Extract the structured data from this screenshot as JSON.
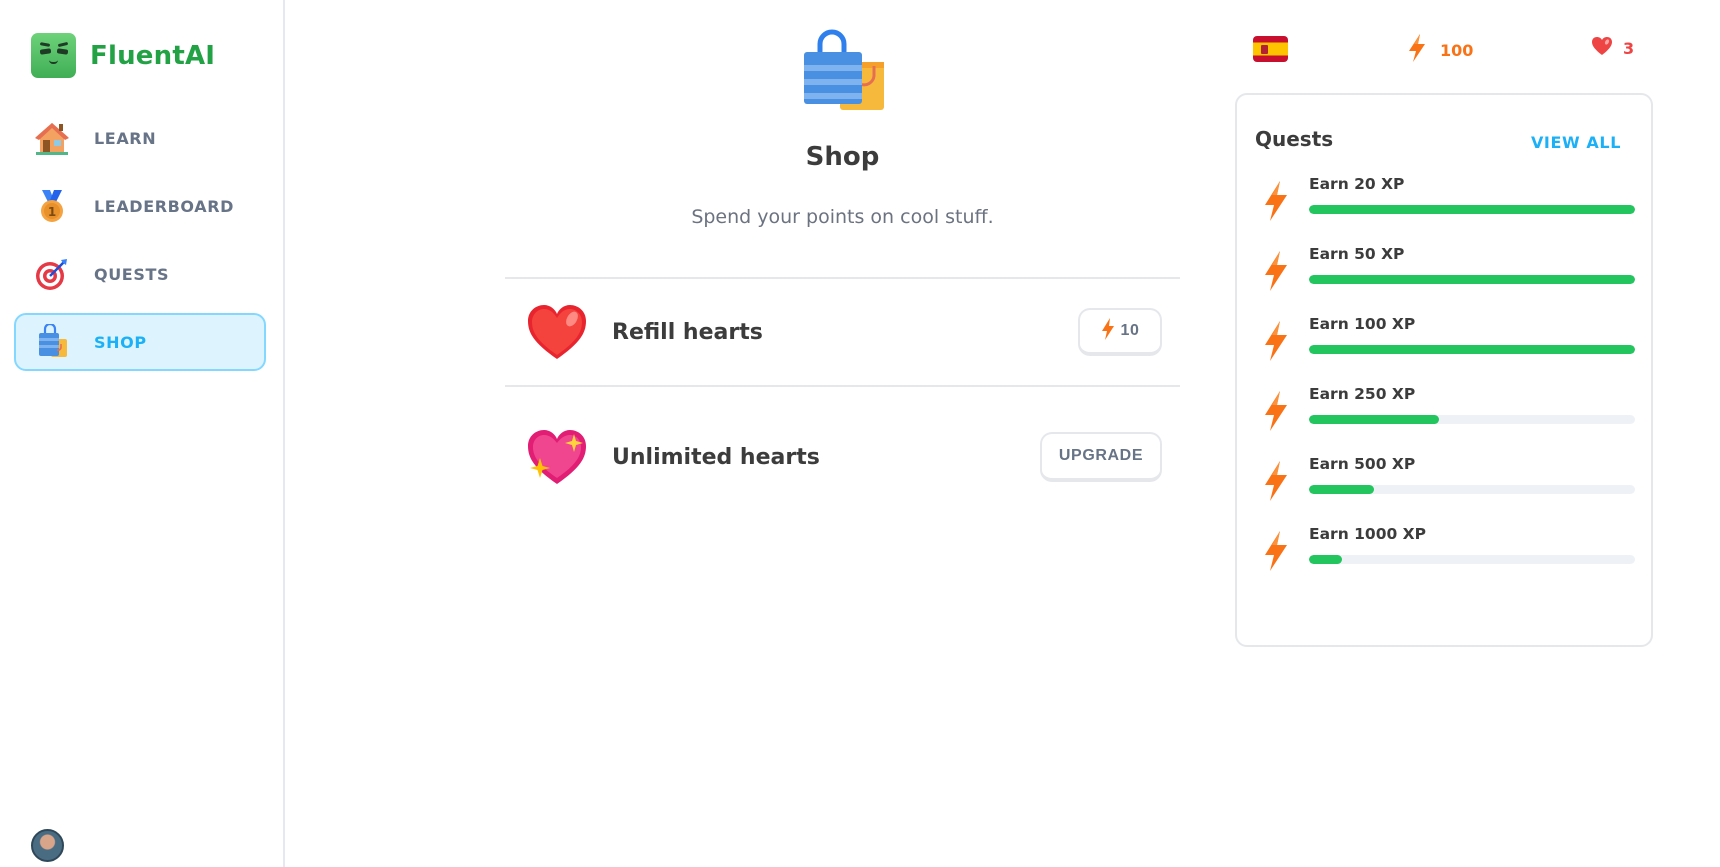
{
  "app": {
    "name": "FluentAI"
  },
  "sidebar": {
    "items": [
      {
        "key": "learn",
        "label": "LEARN",
        "icon": "house-icon",
        "active": false
      },
      {
        "key": "leaderboard",
        "label": "LEADERBOARD",
        "icon": "medal-icon",
        "active": false
      },
      {
        "key": "quests",
        "label": "QUESTS",
        "icon": "target-icon",
        "active": false
      },
      {
        "key": "shop",
        "label": "SHOP",
        "icon": "shopping-bag-icon",
        "active": true
      }
    ],
    "avatar": "user-avatar"
  },
  "main": {
    "hero_icon": "shopping-bag-icon",
    "title": "Shop",
    "subtitle": "Spend your points on cool stuff.",
    "items": [
      {
        "title": "Refill hearts",
        "icon": "heart-icon",
        "button_label": "10",
        "button_icon": "bolt-icon"
      },
      {
        "title": "Unlimited hearts",
        "icon": "sparkling-heart-icon",
        "button_label": "UPGRADE"
      }
    ]
  },
  "stats": {
    "language_flag": "spain-flag-icon",
    "xp": "100",
    "hearts": "3"
  },
  "quests": {
    "title": "Quests",
    "view_all": "VIEW ALL",
    "items": [
      {
        "label": "Earn 20 XP",
        "progress": 1.0
      },
      {
        "label": "Earn 50 XP",
        "progress": 1.0
      },
      {
        "label": "Earn 100 XP",
        "progress": 1.0
      },
      {
        "label": "Earn 250 XP",
        "progress": 0.4
      },
      {
        "label": "Earn 500 XP",
        "progress": 0.2
      },
      {
        "label": "Earn 1000 XP",
        "progress": 0.1
      }
    ]
  },
  "colors": {
    "brand": "#22a245",
    "accent": "#1cb0f6",
    "xp": "#f97316",
    "heart": "#ef4444",
    "progress": "#22c55e"
  }
}
